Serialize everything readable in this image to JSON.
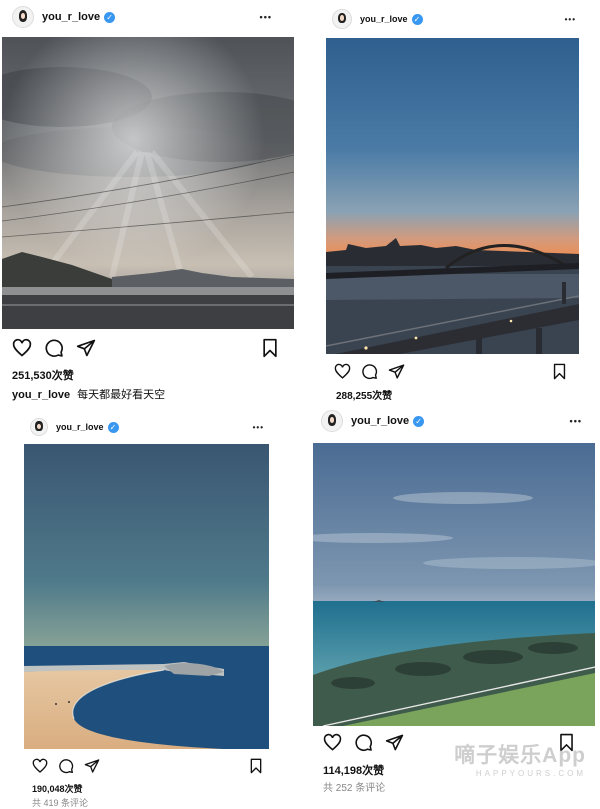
{
  "user": {
    "username": "you_r_love",
    "verified_mark": "✓",
    "more_glyph": "•••"
  },
  "posts": [
    {
      "likes": "251,530次赞",
      "caption_user": "you_r_love",
      "caption_text": "每天都最好看天空"
    },
    {
      "likes": "288,255次赞"
    },
    {
      "likes": "190,048次赞",
      "comments_partial": "共 419 条评论"
    },
    {
      "likes": "114,198次赞",
      "comments_partial": "共 252 条评论"
    }
  ],
  "icons": [
    "heart-icon",
    "comment-icon",
    "share-icon",
    "bookmark-icon",
    "more-icon",
    "verified-icon"
  ],
  "watermark": {
    "text": "嘀子娱乐App",
    "sub": "HAPPYOURS.COM"
  },
  "colors": {
    "verified": "#3897f0",
    "text": "#111111",
    "muted": "#888888"
  }
}
